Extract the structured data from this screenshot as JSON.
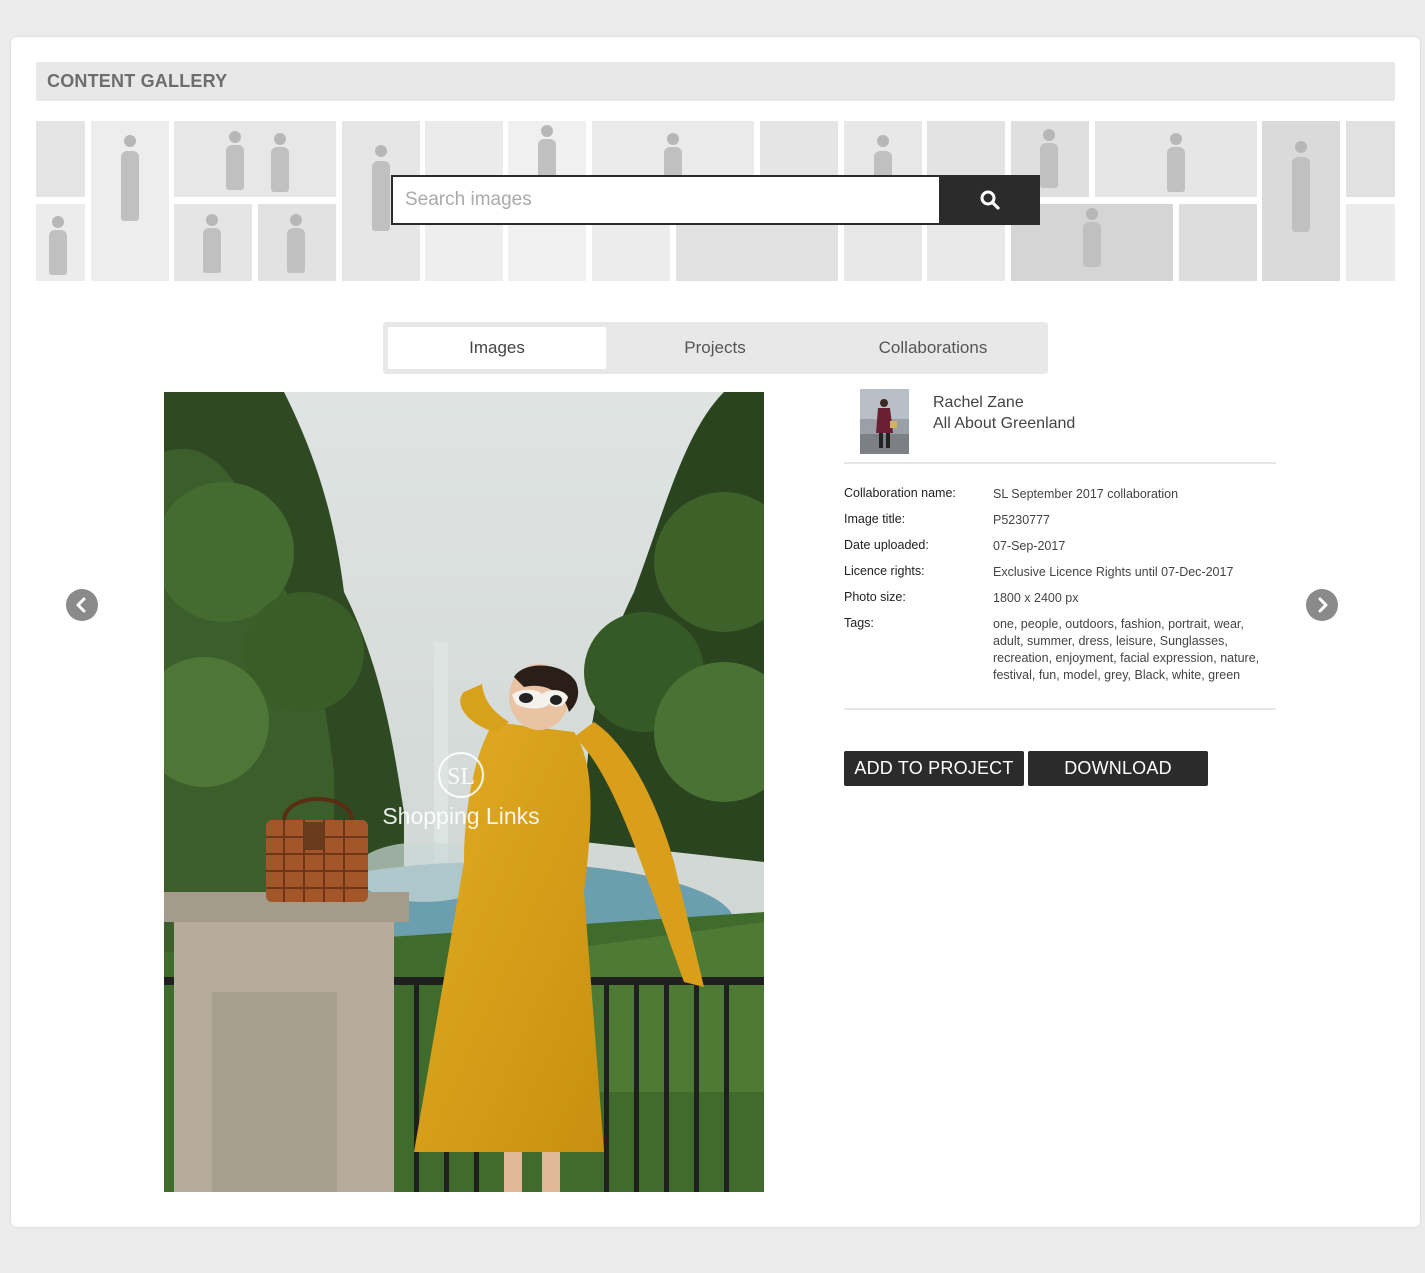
{
  "header": {
    "title": "CONTENT GALLERY"
  },
  "search": {
    "placeholder": "Search images",
    "button_icon": "search-icon"
  },
  "tabs": [
    {
      "label": "Images",
      "active": true
    },
    {
      "label": "Projects",
      "active": false
    },
    {
      "label": "Collaborations",
      "active": false
    }
  ],
  "photo": {
    "watermark": "Shopping Links",
    "watermark_logo": "SL"
  },
  "author": {
    "name": "Rachel Zane",
    "blog": "All About Greenland"
  },
  "details": [
    {
      "label": "Collaboration name:",
      "value": "SL September 2017 collaboration"
    },
    {
      "label": "Image title:",
      "value": "P5230777"
    },
    {
      "label": "Date uploaded:",
      "value": "07-Sep-2017"
    },
    {
      "label": "Licence rights:",
      "value": "Exclusive Licence Rights until 07-Dec-2017"
    },
    {
      "label": "Photo size:",
      "value": "1800 x 2400 px"
    },
    {
      "label": "Tags:",
      "value": "one, people, outdoors, fashion, portrait, wear, adult, summer, dress, leisure, Sunglasses, recreation, enjoyment, facial expression, nature, festival, fun, model, grey, Black, white, green"
    }
  ],
  "actions": {
    "add_to_project": "ADD TO PROJECT",
    "download": "DOWNLOAD"
  },
  "colors": {
    "button": "#2b2b2b",
    "header_bg": "#e8e8e8",
    "page_bg": "#ececec"
  }
}
